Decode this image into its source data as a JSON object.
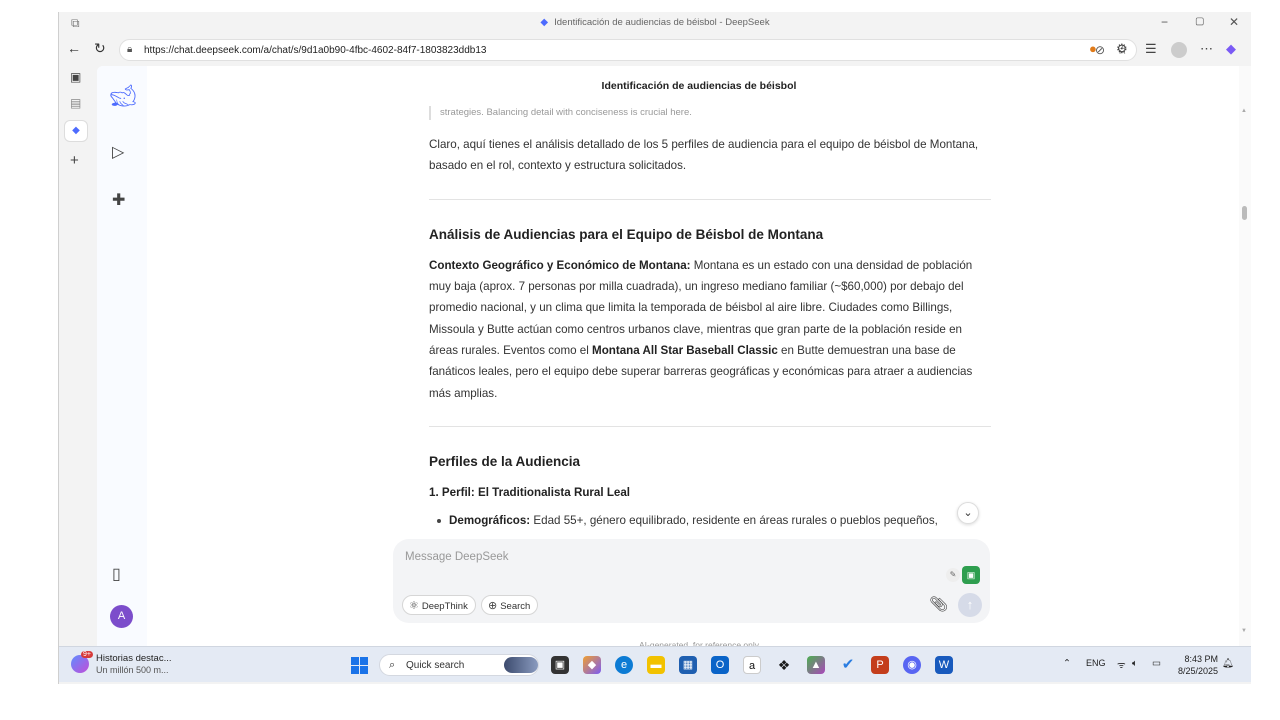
{
  "window": {
    "title": "Identificación de audiencias de béisbol - DeepSeek",
    "controls": [
      "−",
      "▢",
      "✕"
    ]
  },
  "browser": {
    "url": "https://chat.deepseek.com/a/chat/s/9d1a0b90-4fbc-4602-84f7-1803823ddb13"
  },
  "chat": {
    "title": "Identificación de audiencias de béisbol",
    "thinking_tail": "strategies. Balancing detail with conciseness is crucial here.",
    "intro": "Claro, aquí tienes el análisis detallado de los 5 perfiles de audiencia para el equipo de béisbol de Montana, basado en el rol, contexto y estructura solicitados.",
    "section1_heading": "Análisis de Audiencias para el Equipo de Béisbol de Montana",
    "context_label": "Contexto Geográfico y Económico de Montana:",
    "context_text_1": " Montana es un estado con una densidad de población muy baja (aprox. 7 personas por milla cuadrada), un ingreso mediano familiar (~$60,000) por debajo del promedio nacional, y un clima que limita la temporada de béisbol al aire libre. Ciudades como Billings, Missoula y Butte actúan como centros urbanos clave, mientras que gran parte de la población reside en áreas rurales. Eventos como el ",
    "context_bold_event": "Montana All Star Baseball Classic",
    "context_text_2": " en Butte demuestran una base de fanáticos leales, pero el equipo debe superar barreras geográficas y económicas para atraer a audiencias más amplias.",
    "section2_heading": "Perfiles de la Audiencia",
    "profile1_heading": "1. Perfil: El Traditionalista Rural Leal",
    "bullet_label": "Demográficos:",
    "bullet_text": " Edad 55+, género equilibrado, residente en áreas rurales o pueblos pequeños,"
  },
  "composer": {
    "placeholder": "Message DeepSeek",
    "deepthink_label": "DeepThink",
    "search_label": "Search",
    "disclaimer": "AI-generated, for reference only"
  },
  "rail": {
    "avatar_letter": "A"
  },
  "taskbar": {
    "news_title": "Historias destac...",
    "news_sub": "Un millón 500 m...",
    "news_badge": "9+",
    "search_placeholder": "Quick search",
    "lang": "ENG",
    "time": "8:43 PM",
    "date": "8/25/2025"
  },
  "colors": {
    "accent": "#4d6bfe",
    "avatar": "#7c4dcb"
  }
}
